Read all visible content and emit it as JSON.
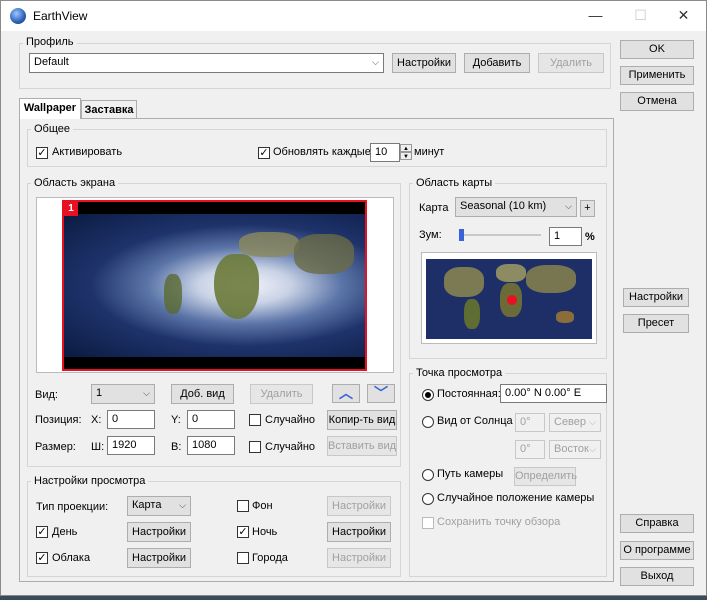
{
  "window": {
    "title": "EarthView",
    "minimize": "—",
    "maximize": "☐",
    "close": "✕"
  },
  "profile": {
    "group_label": "Профиль",
    "value": "Default",
    "settings_btn": "Настройки",
    "add_btn": "Добавить",
    "delete_btn": "Удалить"
  },
  "right_buttons": {
    "ok": "OK",
    "apply": "Применить",
    "cancel": "Отмена",
    "settings": "Настройки",
    "preset": "Пресет",
    "help": "Справка",
    "about": "О программе",
    "exit": "Выход"
  },
  "tabs": [
    {
      "label": "Wallpaper"
    },
    {
      "label": "Заставка"
    }
  ],
  "general": {
    "group_label": "Общее",
    "activate_label": "Активировать",
    "update_label": "Обновлять каждые",
    "update_value": "10",
    "minutes_label": "минут"
  },
  "screen_area": {
    "group_label": "Область экрана",
    "monitor_number": "1"
  },
  "view_controls": {
    "view_label": "Вид:",
    "view_value": "1",
    "add_view_btn": "Доб. вид",
    "delete_btn": "Удалить",
    "up_arrow": "︿",
    "down_arrow": "﹀",
    "position_label": "Позиция:",
    "x_label": "X:",
    "x_value": "0",
    "y_label": "Y:",
    "y_value": "0",
    "random_label_1": "Случайно",
    "copy_view_btn": "Копир-ть вид",
    "size_label": "Размер:",
    "w_label": "Ш:",
    "w_value": "1920",
    "h_label": "В:",
    "h_value": "1080",
    "random_label_2": "Случайно",
    "paste_view_btn": "Вставить вид"
  },
  "map_area": {
    "group_label": "Область карты",
    "map_label": "Карта",
    "map_value": "Seasonal (10 km)",
    "plus_btn": "+",
    "zoom_label": "Зум:",
    "zoom_value": "1",
    "zoom_unit": "%",
    "zoom_fraction": 0.0
  },
  "viewpoint": {
    "group_label": "Точка просмотра",
    "constant_label": "Постоянная:",
    "constant_value": "0.00° N  0.00° E",
    "sun_label": "Вид от Солнца +",
    "sun_lat_value": "0°",
    "sun_lat_dir": "Север",
    "sun_lon_value": "0°",
    "sun_lon_dir": "Восток",
    "camera_path_label": "Путь камеры",
    "define_btn": "Определить",
    "random_camera_label": "Случайное положение камеры",
    "save_viewpoint_label": "Сохранить точку обзора"
  },
  "view_settings": {
    "group_label": "Настройки просмотра",
    "projection_label": "Тип проекции:",
    "projection_value": "Карта",
    "background_label": "Фон",
    "background_settings": "Настройки",
    "day_label": "День",
    "day_settings": "Настройки",
    "night_label": "Ночь",
    "night_settings": "Настройки",
    "clouds_label": "Облака",
    "clouds_settings": "Настройки",
    "cities_label": "Города",
    "cities_settings": "Настройки"
  },
  "colors": {
    "accent_red": "#e81123",
    "arrow_blue": "#3a62d8",
    "ocean": "#1d2f66"
  }
}
